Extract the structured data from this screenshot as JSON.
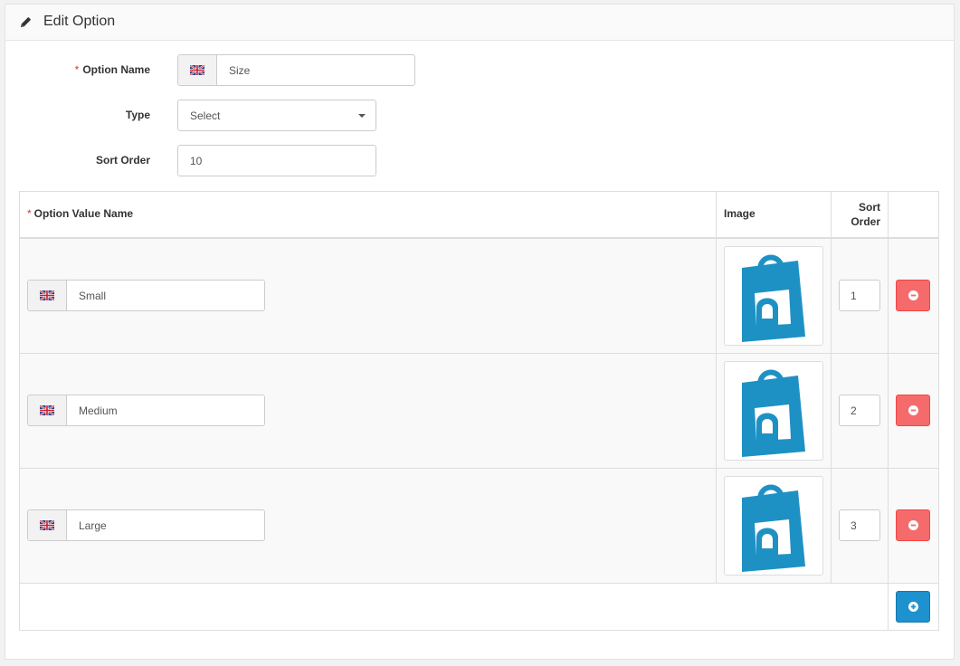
{
  "panel": {
    "title": "Edit Option",
    "icon": "pencil-icon"
  },
  "form": {
    "option_name": {
      "label": "Option Name",
      "required_mark": "*",
      "value": "Size",
      "flag_icon": "uk-flag-icon"
    },
    "type": {
      "label": "Type",
      "value": "Select"
    },
    "sort_order": {
      "label": "Sort Order",
      "value": "10"
    }
  },
  "table": {
    "headers": {
      "required_mark": "*",
      "option_value_name": "Option Value Name",
      "image": "Image",
      "sort_order": "Sort Order"
    },
    "rows": [
      {
        "name": "Small",
        "sort_order": "1"
      },
      {
        "name": "Medium",
        "sort_order": "2"
      },
      {
        "name": "Large",
        "sort_order": "3"
      }
    ]
  },
  "colors": {
    "danger": "#f56b6b",
    "primary": "#1e91cf",
    "logo": "#1e91c4",
    "required": "#e0332e"
  }
}
